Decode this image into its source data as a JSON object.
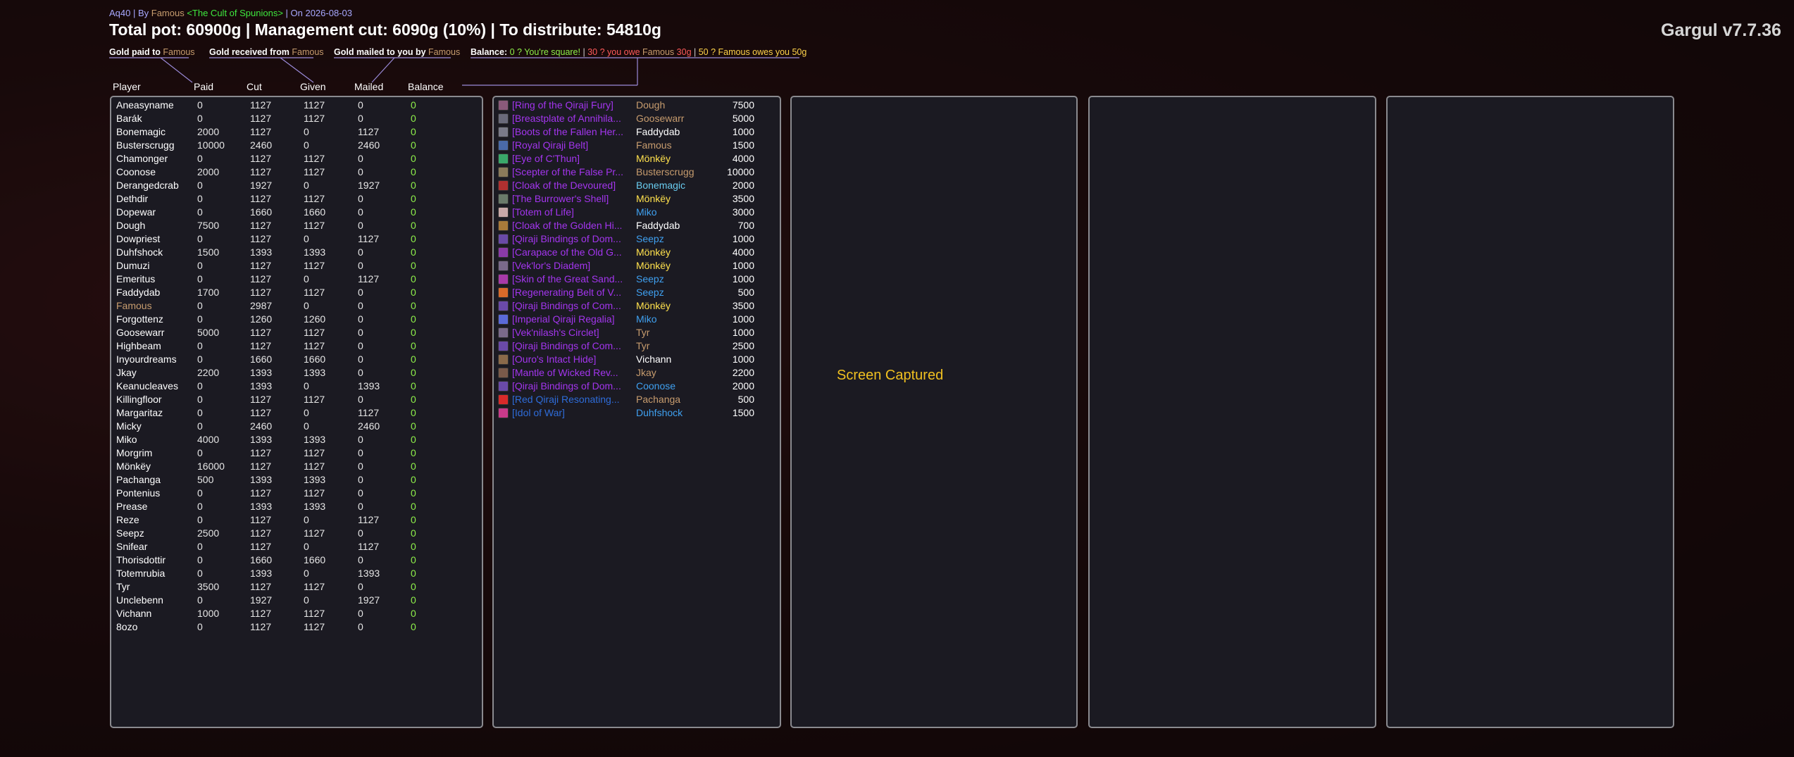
{
  "window": {
    "subtitle": {
      "prefix": "Aq40 | By ",
      "author": "Famous",
      "guild": " <The Cult of Spunions>",
      "date": " | On 2026-08-03"
    },
    "title": "Total pot: 60900g | Management cut: 6090g (10%) | To distribute: 54810g",
    "brand": "Gargul v7.7.36"
  },
  "legend": {
    "paid_label": "Gold paid to ",
    "paid_name": "Famous",
    "received_label": "Gold received from ",
    "received_name": "Famous",
    "mailed_label": "Gold mailed to you by ",
    "mailed_name": "Famous",
    "balance_label": "Balance: ",
    "balance_square": "0 ? You're square!",
    "sep1": " | ",
    "balance_owe_prefix": "30 ? you owe ",
    "balance_owe_name": "Famous",
    "balance_owe_amount": " 30g",
    "sep2": " | ",
    "balance_owes_you": "50 ? Famous owes you 50g"
  },
  "columns": [
    "Player",
    "Paid",
    "Cut",
    "Given",
    "Mailed",
    "Balance"
  ],
  "players": [
    {
      "name": "Aneasyname",
      "paid": "0",
      "cut": "1127",
      "given": "1127",
      "mailed": "0",
      "balance": "0"
    },
    {
      "name": "Barák",
      "paid": "0",
      "cut": "1127",
      "given": "1127",
      "mailed": "0",
      "balance": "0"
    },
    {
      "name": "Bonemagic",
      "paid": "2000",
      "cut": "1127",
      "given": "0",
      "mailed": "1127",
      "balance": "0"
    },
    {
      "name": "Busterscrugg",
      "paid": "10000",
      "cut": "2460",
      "given": "0",
      "mailed": "2460",
      "balance": "0"
    },
    {
      "name": "Chamonger",
      "paid": "0",
      "cut": "1127",
      "given": "1127",
      "mailed": "0",
      "balance": "0"
    },
    {
      "name": "Coonose",
      "paid": "2000",
      "cut": "1127",
      "given": "1127",
      "mailed": "0",
      "balance": "0"
    },
    {
      "name": "Derangedcrab",
      "paid": "0",
      "cut": "1927",
      "given": "0",
      "mailed": "1927",
      "balance": "0"
    },
    {
      "name": "Dethdir",
      "paid": "0",
      "cut": "1127",
      "given": "1127",
      "mailed": "0",
      "balance": "0"
    },
    {
      "name": "Dopewar",
      "paid": "0",
      "cut": "1660",
      "given": "1660",
      "mailed": "0",
      "balance": "0"
    },
    {
      "name": "Dough",
      "paid": "7500",
      "cut": "1127",
      "given": "1127",
      "mailed": "0",
      "balance": "0"
    },
    {
      "name": "Dowpriest",
      "paid": "0",
      "cut": "1127",
      "given": "0",
      "mailed": "1127",
      "balance": "0"
    },
    {
      "name": "Duhfshock",
      "paid": "1500",
      "cut": "1393",
      "given": "1393",
      "mailed": "0",
      "balance": "0"
    },
    {
      "name": "Dumuzi",
      "paid": "0",
      "cut": "1127",
      "given": "1127",
      "mailed": "0",
      "balance": "0"
    },
    {
      "name": "Emeritus",
      "paid": "0",
      "cut": "1127",
      "given": "0",
      "mailed": "1127",
      "balance": "0"
    },
    {
      "name": "Faddydab",
      "paid": "1700",
      "cut": "1127",
      "given": "1127",
      "mailed": "0",
      "balance": "0"
    },
    {
      "name": "Famous",
      "paid": "0",
      "cut": "2987",
      "given": "0",
      "mailed": "0",
      "balance": "0",
      "highlight": true
    },
    {
      "name": "Forgottenz",
      "paid": "0",
      "cut": "1260",
      "given": "1260",
      "mailed": "0",
      "balance": "0"
    },
    {
      "name": "Goosewarr",
      "paid": "5000",
      "cut": "1127",
      "given": "1127",
      "mailed": "0",
      "balance": "0"
    },
    {
      "name": "Highbeam",
      "paid": "0",
      "cut": "1127",
      "given": "1127",
      "mailed": "0",
      "balance": "0"
    },
    {
      "name": "Inyourdreams",
      "paid": "0",
      "cut": "1660",
      "given": "1660",
      "mailed": "0",
      "balance": "0"
    },
    {
      "name": "Jkay",
      "paid": "2200",
      "cut": "1393",
      "given": "1393",
      "mailed": "0",
      "balance": "0"
    },
    {
      "name": "Keanucleaves",
      "paid": "0",
      "cut": "1393",
      "given": "0",
      "mailed": "1393",
      "balance": "0"
    },
    {
      "name": "Killingfloor",
      "paid": "0",
      "cut": "1127",
      "given": "1127",
      "mailed": "0",
      "balance": "0"
    },
    {
      "name": "Margaritaz",
      "paid": "0",
      "cut": "1127",
      "given": "0",
      "mailed": "1127",
      "balance": "0"
    },
    {
      "name": "Micky",
      "paid": "0",
      "cut": "2460",
      "given": "0",
      "mailed": "2460",
      "balance": "0"
    },
    {
      "name": "Miko",
      "paid": "4000",
      "cut": "1393",
      "given": "1393",
      "mailed": "0",
      "balance": "0"
    },
    {
      "name": "Morgrim",
      "paid": "0",
      "cut": "1127",
      "given": "1127",
      "mailed": "0",
      "balance": "0"
    },
    {
      "name": "Mönkëy",
      "paid": "16000",
      "cut": "1127",
      "given": "1127",
      "mailed": "0",
      "balance": "0"
    },
    {
      "name": "Pachanga",
      "paid": "500",
      "cut": "1393",
      "given": "1393",
      "mailed": "0",
      "balance": "0"
    },
    {
      "name": "Pontenius",
      "paid": "0",
      "cut": "1127",
      "given": "1127",
      "mailed": "0",
      "balance": "0"
    },
    {
      "name": "Prease",
      "paid": "0",
      "cut": "1393",
      "given": "1393",
      "mailed": "0",
      "balance": "0"
    },
    {
      "name": "Reze",
      "paid": "0",
      "cut": "1127",
      "given": "0",
      "mailed": "1127",
      "balance": "0"
    },
    {
      "name": "Seepz",
      "paid": "2500",
      "cut": "1127",
      "given": "1127",
      "mailed": "0",
      "balance": "0"
    },
    {
      "name": "Snifear",
      "paid": "0",
      "cut": "1127",
      "given": "0",
      "mailed": "1127",
      "balance": "0"
    },
    {
      "name": "Thorisdottir",
      "paid": "0",
      "cut": "1660",
      "given": "1660",
      "mailed": "0",
      "balance": "0"
    },
    {
      "name": "Totemrubia",
      "paid": "0",
      "cut": "1393",
      "given": "0",
      "mailed": "1393",
      "balance": "0"
    },
    {
      "name": "Tyr",
      "paid": "3500",
      "cut": "1127",
      "given": "1127",
      "mailed": "0",
      "balance": "0"
    },
    {
      "name": "Unclebenn",
      "paid": "0",
      "cut": "1927",
      "given": "0",
      "mailed": "1927",
      "balance": "0"
    },
    {
      "name": "Vichann",
      "paid": "1000",
      "cut": "1127",
      "given": "1127",
      "mailed": "0",
      "balance": "0"
    },
    {
      "name": "8ozo",
      "paid": "0",
      "cut": "1127",
      "given": "1127",
      "mailed": "0",
      "balance": "0"
    }
  ],
  "loot": [
    {
      "item": "[Ring of the Qiraji Fury]",
      "winner": "Dough",
      "price": "7500",
      "item_color": "purple",
      "winner_color": "tan",
      "icon_color": "#8a5a7a"
    },
    {
      "item": "[Breastplate of Annihila...",
      "winner": "Goosewarr",
      "price": "5000",
      "item_color": "purple",
      "winner_color": "tan",
      "icon_color": "#6a6a7a"
    },
    {
      "item": "[Boots of the Fallen Her...",
      "winner": "Faddydab",
      "price": "1000",
      "item_color": "purple",
      "winner_color": "white",
      "icon_color": "#7a7a88"
    },
    {
      "item": "[Royal Qiraji Belt]",
      "winner": "Famous",
      "price": "1500",
      "item_color": "purple",
      "winner_color": "tan",
      "icon_color": "#4a6aa8"
    },
    {
      "item": "[Eye of C'Thun]",
      "winner": "Mönkëy",
      "price": "4000",
      "item_color": "purple",
      "winner_color": "yellow",
      "icon_color": "#3aa86a"
    },
    {
      "item": "[Scepter of the False Pr...",
      "winner": "Busterscrugg",
      "price": "10000",
      "item_color": "purple",
      "winner_color": "tan",
      "icon_color": "#8a7a5a"
    },
    {
      "item": "[Cloak of the Devoured]",
      "winner": "Bonemagic",
      "price": "2000",
      "item_color": "purple",
      "winner_color": "lightblue",
      "icon_color": "#b03030"
    },
    {
      "item": "[The Burrower's Shell]",
      "winner": "Mönkëy",
      "price": "3500",
      "item_color": "purple",
      "winner_color": "yellow",
      "icon_color": "#6a7a6a"
    },
    {
      "item": "[Totem of Life]",
      "winner": "Miko",
      "price": "3000",
      "item_color": "purple",
      "winner_color": "blue",
      "icon_color": "#c8a8a8"
    },
    {
      "item": "[Cloak of the Golden Hi...",
      "winner": "Faddydab",
      "price": "700",
      "item_color": "purple",
      "winner_color": "white",
      "icon_color": "#a87a3a"
    },
    {
      "item": "[Qiraji Bindings of Dom...",
      "winner": "Seepz",
      "price": "1000",
      "item_color": "purple",
      "winner_color": "blue",
      "icon_color": "#6a4aa8"
    },
    {
      "item": "[Carapace of the Old G...",
      "winner": "Mönkëy",
      "price": "4000",
      "item_color": "purple",
      "winner_color": "yellow",
      "icon_color": "#8a3aa8"
    },
    {
      "item": "[Vek'lor's Diadem]",
      "winner": "Mönkëy",
      "price": "1000",
      "item_color": "purple",
      "winner_color": "yellow",
      "icon_color": "#7a6a8a"
    },
    {
      "item": "[Skin of the Great Sand...",
      "winner": "Seepz",
      "price": "1000",
      "item_color": "purple",
      "winner_color": "blue",
      "icon_color": "#a83aa8"
    },
    {
      "item": "[Regenerating Belt of V...",
      "winner": "Seepz",
      "price": "500",
      "item_color": "purple",
      "winner_color": "blue",
      "icon_color": "#d86a2a"
    },
    {
      "item": "[Qiraji Bindings of Com...",
      "winner": "Mönkëy",
      "price": "3500",
      "item_color": "purple",
      "winner_color": "yellow",
      "icon_color": "#6a4aa8"
    },
    {
      "item": "[Imperial Qiraji Regalia]",
      "winner": "Miko",
      "price": "1000",
      "item_color": "purple",
      "winner_color": "blue",
      "icon_color": "#5a6ad8"
    },
    {
      "item": "[Vek'nilash's Circlet]",
      "winner": "Tyr",
      "price": "1000",
      "item_color": "purple",
      "winner_color": "tan",
      "icon_color": "#7a6a8a"
    },
    {
      "item": "[Qiraji Bindings of Com...",
      "winner": "Tyr",
      "price": "2500",
      "item_color": "purple",
      "winner_color": "tan",
      "icon_color": "#6a4aa8"
    },
    {
      "item": "[Ouro's Intact Hide]",
      "winner": "Vichann",
      "price": "1000",
      "item_color": "purple",
      "winner_color": "white",
      "icon_color": "#8a6a4a"
    },
    {
      "item": "[Mantle of Wicked Rev...",
      "winner": "Jkay",
      "price": "2200",
      "item_color": "purple",
      "winner_color": "tan",
      "icon_color": "#7a5a4a"
    },
    {
      "item": "[Qiraji Bindings of Dom...",
      "winner": "Coonose",
      "price": "2000",
      "item_color": "purple",
      "winner_color": "blue",
      "icon_color": "#6a4aa8"
    },
    {
      "item": "[Red Qiraji Resonating...",
      "winner": "Pachanga",
      "price": "500",
      "item_color": "blue",
      "winner_color": "tan",
      "icon_color": "#d82a2a"
    },
    {
      "item": "[Idol of War]",
      "winner": "Duhfshock",
      "price": "1500",
      "item_color": "blue",
      "winner_color": "blue",
      "icon_color": "#c83a8a"
    }
  ],
  "screen_captured": "Screen Captured"
}
